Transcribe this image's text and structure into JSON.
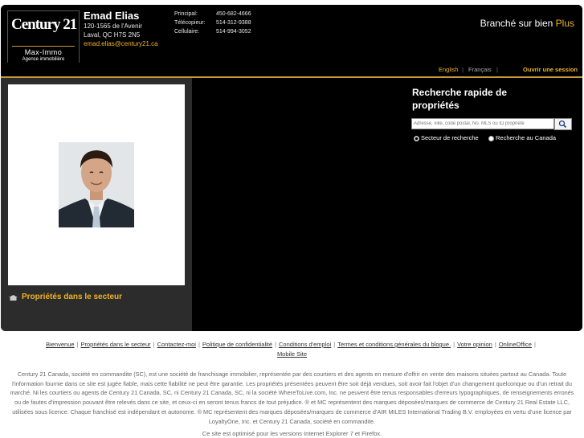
{
  "header": {
    "logo": {
      "brand": "Century 21",
      "office": "Max-Immo",
      "subtitle": "Agence immobilière"
    },
    "agent": {
      "name": "Emad Elias",
      "address_line1": "120-1565 de l'Avenir",
      "address_line2": "Laval, QC  H7S 2N5",
      "email": "emad.elias@century21.ca"
    },
    "phones": [
      {
        "label": "Principal:",
        "value": "450-682-4666"
      },
      {
        "label": "Télécopieur:",
        "value": "514-312-9388"
      },
      {
        "label": "Cellulaire:",
        "value": "514-994-3052"
      }
    ],
    "tagline": {
      "text": "Branché sur bien",
      "accent": "Plus"
    }
  },
  "langbar": {
    "english": "English",
    "francais": "Français",
    "open_session": "Ouvrir une session"
  },
  "left": {
    "nearby_label": "Propriétés dans le secteur"
  },
  "search": {
    "title": "Recherche rapide de propriétés",
    "placeholder": "Adresse, ville, code postal, No. MLS ou ID propriété",
    "options": [
      "Secteur de recherche",
      "Recherche au Canada"
    ],
    "selected_option": "Secteur de recherche"
  },
  "footer": {
    "links": [
      "Bienvenue",
      "Propriétés dans le secteur",
      "Contactez-moi",
      "Politique de confidentialité",
      "Conditions d'emploi",
      "Termes et conditions générales du blogue.",
      "Votre opinion",
      "OnlineOffice",
      "Mobile Site"
    ],
    "disclaimer": "Century 21 Canada, société en commandite (SC), est une société de franchisage immobilier, représentée par des courtiers et des agents en mesure d'offrir en vente des maisons situées partout au Canada. Toute l'information fournie dans ce site est jugée fiable, mais cette fiabilité ne peut être garantie. Les propriétés présentées peuvent être soit déjà vendues, soit avoir fait l'objet d'un changement quelconque ou d'un retrait du marché. Ni les courtiers ou agents de Century 21 Canada, SC, ni Century 21 Canada, SC, ni la société WhereToLive.com, Inc. ne peuvent être tenus responsables d'erreurs typographiques, de renseignements erronés ou de fautes d'impression pouvant être relevés dans ce site, et ceux-ci en seront tenus francs de tout préjudice. ® et MC représentent des marques déposées/marques de commerce de Century 21 Real Estate LLC, utilisées sous licence. Chaque franchisé est indépendant et autonome. ® MC représentent des marques déposées/marques de commerce d'AIR MILES International Trading B.V. employées en vertu d'une licence par LoyaltyOne, Inc. et Century 21 Canada, société en commandite.",
    "optimized": "Ce site est optimisé pour les versions Internet Explorer 7 et Firefox."
  },
  "colors": {
    "accent": "#f0b323",
    "gold_rule": "#c59a3a",
    "background": "#000000",
    "panel": "#2c2c2c"
  },
  "icons": {
    "search": "magnifier-icon",
    "nearby": "house-icon"
  }
}
